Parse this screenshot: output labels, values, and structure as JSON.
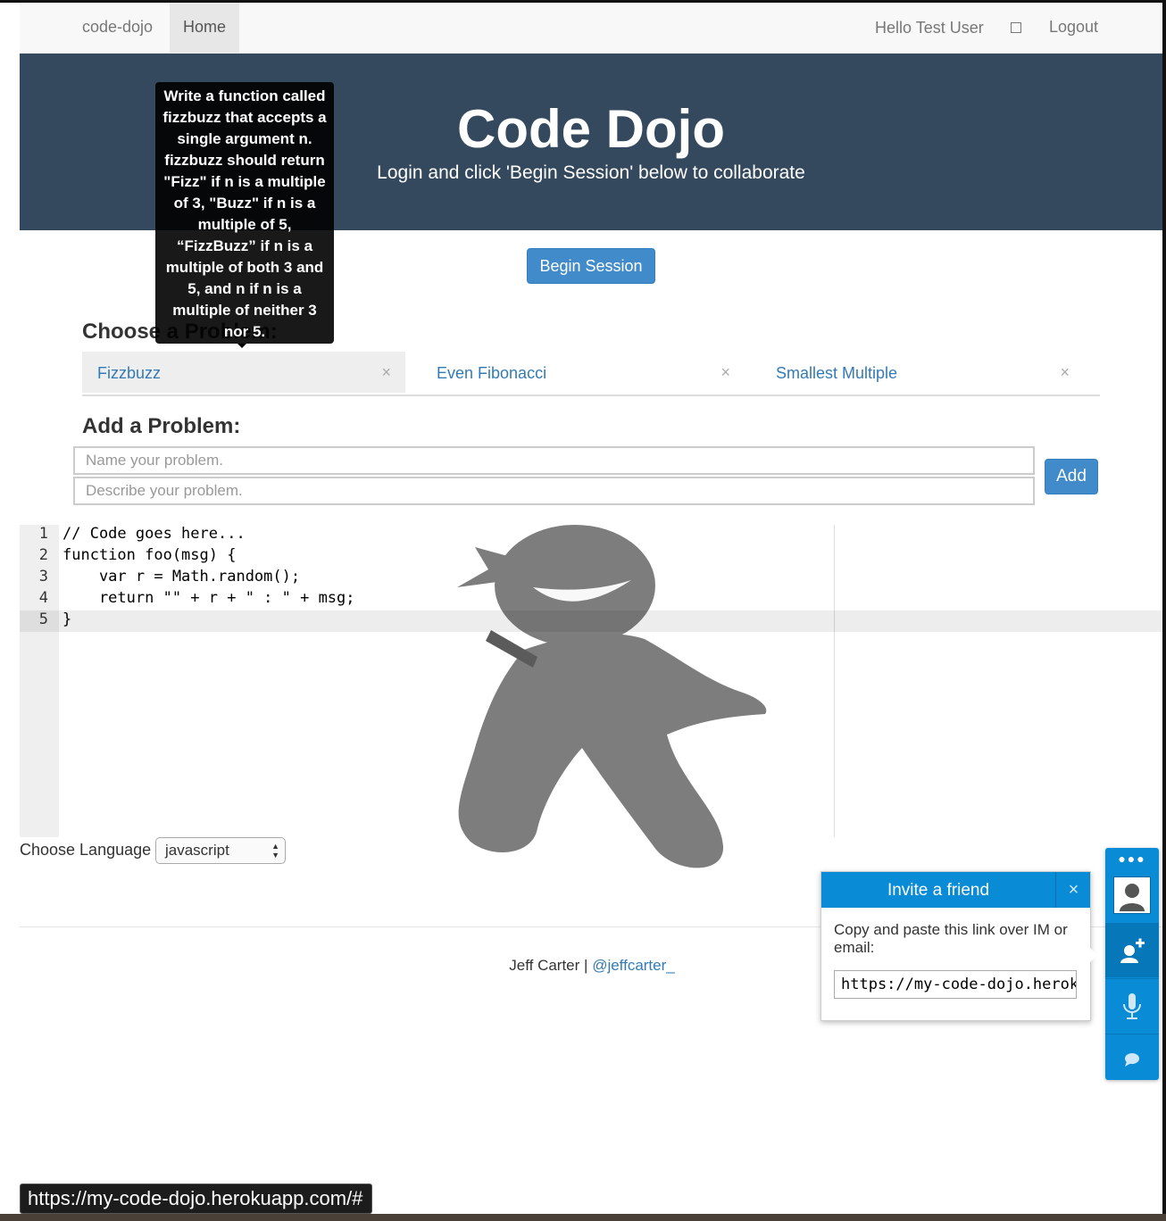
{
  "navbar": {
    "brand": "code-dojo",
    "home": "Home",
    "greeting": "Hello Test User",
    "logout": "Logout"
  },
  "jumbotron": {
    "title": "Code Dojo",
    "subtitle": "Login and click 'Begin Session' below to collaborate"
  },
  "begin_session": "Begin Session",
  "tooltip": "Write a function called fizzbuzz that accepts a single argument n. fizzbuzz should return \"Fizz\" if n is a multiple of 3, \"Buzz\" if n is a multiple of 5, “FizzBuzz” if n is a multiple of both 3 and 5, and n if n is a multiple of neither 3 nor 5.",
  "choose_problem": {
    "title": "Choose a Problem:",
    "tabs": [
      {
        "label": "Fizzbuzz",
        "close": "×",
        "active": true
      },
      {
        "label": "Even Fibonacci",
        "close": "×",
        "active": false
      },
      {
        "label": "Smallest Multiple",
        "close": "×",
        "active": false
      }
    ]
  },
  "add_problem": {
    "title": "Add a Problem:",
    "name_placeholder": "Name your problem.",
    "describe_placeholder": "Describe your problem.",
    "add_label": "Add"
  },
  "editor": {
    "line_numbers": [
      "1",
      "2",
      "3",
      "4",
      "5"
    ],
    "lines": [
      "// Code goes here...",
      "function foo(msg) {",
      "    var r = Math.random();",
      "    return \"\" + r + \" : \" + msg;",
      "}"
    ],
    "active_line": 5
  },
  "language": {
    "label": "Choose Language",
    "selected": "javascript"
  },
  "footer": {
    "author": "Jeff Carter",
    "separator": " | ",
    "handle": "@jeffcarter_"
  },
  "invite": {
    "title": "Invite a friend",
    "close": "×",
    "instructions": "Copy and paste this link over IM or email:",
    "link": "https://my-code-dojo.herokuapp.com/#"
  },
  "side_toolbar": {
    "menu_icon": "more-dots-icon",
    "buttons": [
      "add-user-icon",
      "microphone-icon",
      "chat-bubble-icon"
    ],
    "accent": "#0a8bd5"
  },
  "status_url": "https://my-code-dojo.herokuapp.com/#",
  "colors": {
    "jumbotron": "#34495e",
    "primary": "#428bca",
    "link": "#337ab7"
  }
}
